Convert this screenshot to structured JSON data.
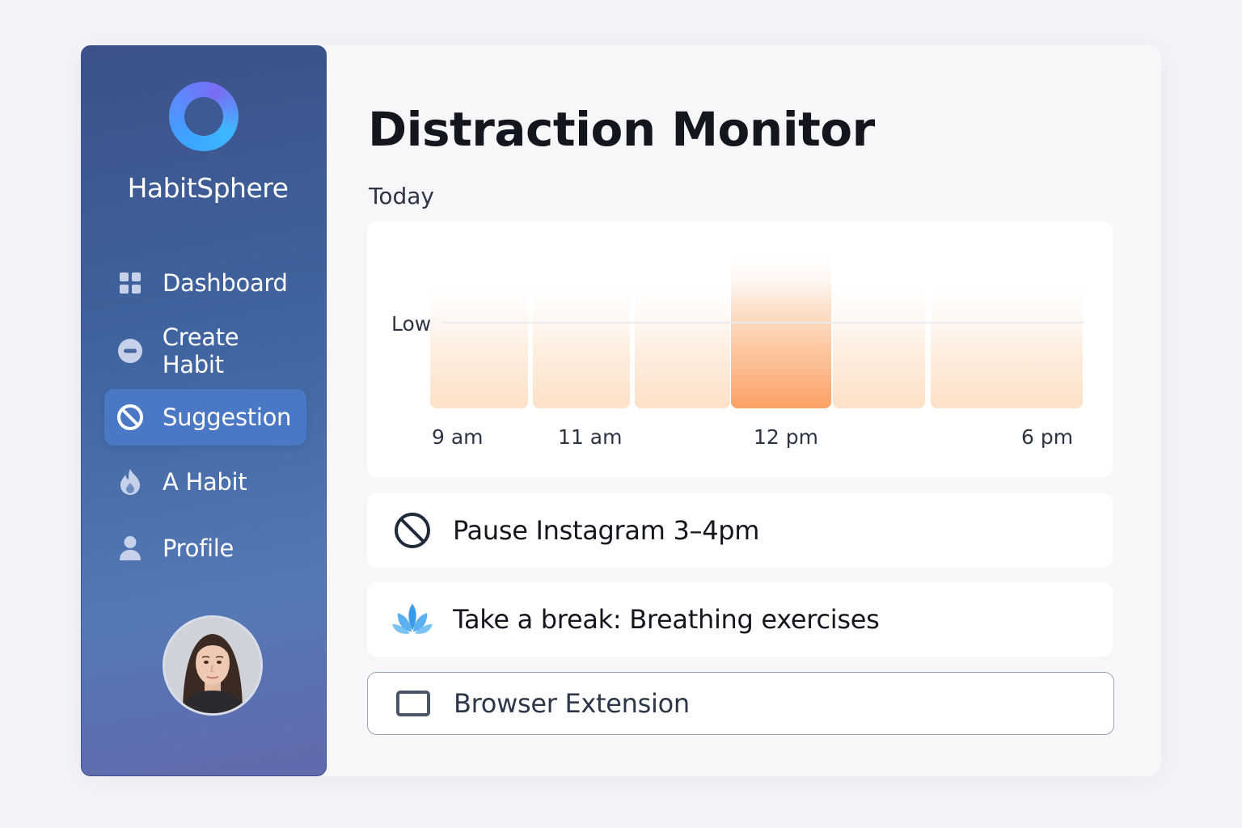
{
  "app": {
    "brand": "HabitSphere"
  },
  "sidebar": {
    "items": [
      {
        "label": "Dashboard",
        "icon": "grid-icon",
        "active": false
      },
      {
        "label": "Create Habit",
        "icon": "minus-circle-icon",
        "active": false
      },
      {
        "label": "Suggestion",
        "icon": "block-icon",
        "active": true
      },
      {
        "label": "A Habit",
        "icon": "flame-icon",
        "active": false
      },
      {
        "label": "Profile",
        "icon": "user-icon",
        "active": false
      }
    ]
  },
  "main": {
    "title": "Distraction Monitor",
    "subtitle": "Today"
  },
  "chart_data": {
    "type": "bar",
    "title": "",
    "ylabel": "",
    "xlabel": "",
    "y_tick_labels": [
      "Low"
    ],
    "x_tick_labels": [
      "9 am",
      "11 am",
      "12 pm",
      "6 pm"
    ],
    "categories": [
      "9 am",
      "11 am",
      "",
      "12 pm",
      "",
      "6 pm"
    ],
    "values": [
      0.82,
      0.82,
      0.82,
      1.0,
      0.82,
      0.82
    ],
    "highlight_index": 3,
    "colors": {
      "highlight": "#fba264",
      "faint": "#fde3cc",
      "gridline": "#ececef"
    }
  },
  "suggestions": [
    {
      "label": "Pause Instagram 3–4pm",
      "icon": "block-icon"
    },
    {
      "label": "Take a break:  Breathing exercises",
      "icon": "lotus-icon"
    }
  ],
  "extension": {
    "label": "Browser Extension",
    "icon": "browser-window-icon"
  },
  "colors": {
    "sidebar_gradient_top": "#3c5188",
    "sidebar_gradient_bottom": "#6269ad",
    "active_nav": "#4a78c4",
    "accent_orange": "#fba264",
    "lotus_blue": "#3b9ae8"
  }
}
